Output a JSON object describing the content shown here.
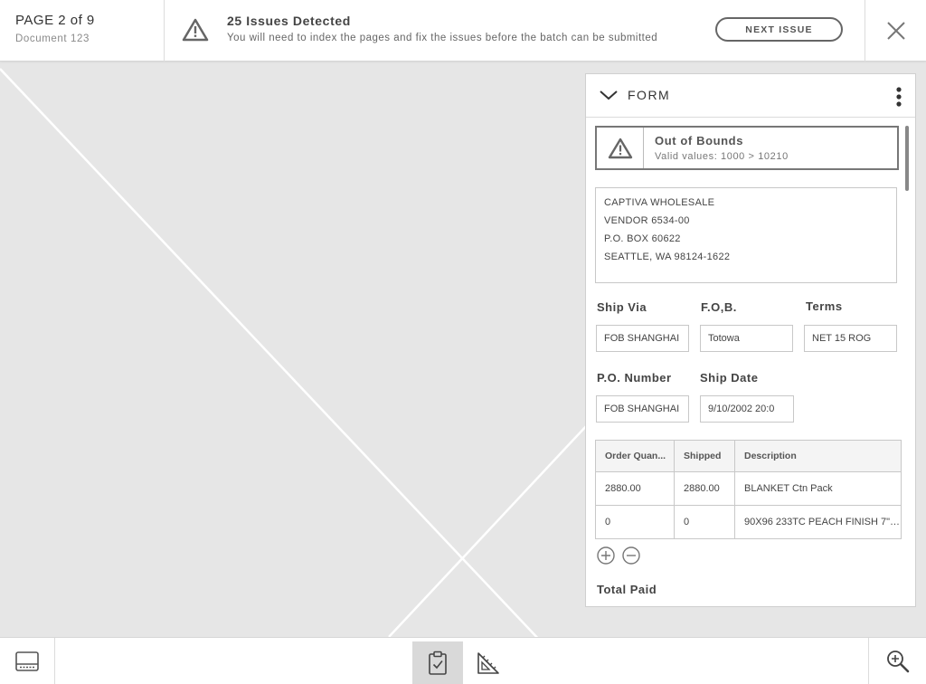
{
  "header": {
    "page_label": "PAGE 2 of 9",
    "document_name": "Document 123",
    "issues_title": "25 Issues Detected",
    "issues_description": "You will need to index the pages and fix the issues before the batch can be submitted",
    "next_issue_label": "NEXT ISSUE"
  },
  "form": {
    "title": "FORM",
    "error": {
      "title": "Out of Bounds",
      "description": "Valid values: 1000 > 10210"
    },
    "address_lines": [
      "CAPTIVA WHOLESALE",
      "VENDOR 6534-00",
      "P.O. BOX 60622",
      "SEATTLE, WA 98124-1622"
    ],
    "fields": {
      "ship_via": {
        "label": "Ship Via",
        "value": "FOB SHANGHAI"
      },
      "fob": {
        "label": "F.O,B.",
        "value": "Totowa"
      },
      "terms": {
        "label": "Terms",
        "value": "NET 15 ROG"
      },
      "po_number": {
        "label": "P.O. Number",
        "value": "FOB SHANGHAI"
      },
      "ship_date": {
        "label": "Ship Date",
        "value": "9/10/2002 20:0"
      }
    },
    "table": {
      "headers": [
        "Order Quan...",
        "Shipped",
        "Description"
      ],
      "rows": [
        [
          "2880.00",
          "2880.00",
          "BLANKET Ctn Pack"
        ],
        [
          "0",
          "0",
          "90X96 233TC PEACH FINISH 7\" ..."
        ]
      ]
    },
    "total_paid_label": "Total Paid"
  },
  "icons": {
    "warning": "warning-triangle-icon",
    "close": "close-icon",
    "chevron": "chevron-down-icon",
    "menu": "kebab-menu-icon",
    "add": "plus-circle-icon",
    "remove": "minus-circle-icon",
    "thumbnails": "thumbnail-strip-icon",
    "clipboard": "clipboard-check-icon",
    "ruler": "ruler-triangle-icon",
    "zoom": "zoom-in-icon"
  },
  "colors": {
    "canvas": "#e6e6e6",
    "accent": "#777777"
  }
}
